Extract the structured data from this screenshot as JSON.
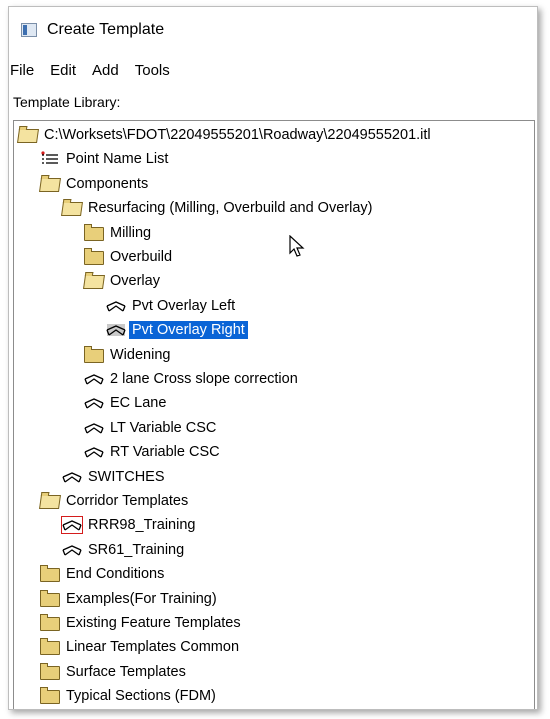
{
  "window": {
    "title": "Create Template"
  },
  "menu": {
    "file": "File",
    "edit": "Edit",
    "add": "Add",
    "tools": "Tools"
  },
  "library_label": "Template Library:",
  "tree": [
    {
      "label": "C:\\Worksets\\FDOT\\22049555201\\Roadway\\22049555201.itl",
      "icon": "folder-open-icon",
      "depth": 0
    },
    {
      "label": "Point Name List",
      "icon": "point-list-icon",
      "depth": 1
    },
    {
      "label": "Components",
      "icon": "folder-open-icon",
      "depth": 1
    },
    {
      "label": "Resurfacing (Milling, Overbuild and Overlay)",
      "icon": "folder-open-icon",
      "depth": 2
    },
    {
      "label": "Milling",
      "icon": "folder-closed-icon",
      "depth": 3
    },
    {
      "label": "Overbuild",
      "icon": "folder-closed-icon",
      "depth": 3
    },
    {
      "label": "Overlay",
      "icon": "folder-open-icon",
      "depth": 3
    },
    {
      "label": "Pvt Overlay Left",
      "icon": "template-icon",
      "depth": 4
    },
    {
      "label": "Pvt Overlay Right",
      "icon": "template-icon-active",
      "depth": 4,
      "selected": true
    },
    {
      "label": "Widening",
      "icon": "folder-closed-icon",
      "depth": 3
    },
    {
      "label": "2 lane Cross slope correction",
      "icon": "template-icon",
      "depth": 3
    },
    {
      "label": "EC Lane",
      "icon": "template-icon",
      "depth": 3
    },
    {
      "label": "LT Variable CSC",
      "icon": "template-icon",
      "depth": 3
    },
    {
      "label": "RT Variable CSC",
      "icon": "template-icon",
      "depth": 3
    },
    {
      "label": "SWITCHES",
      "icon": "template-icon",
      "depth": 2
    },
    {
      "label": "Corridor Templates",
      "icon": "folder-open-icon",
      "depth": 1
    },
    {
      "label": "RRR98_Training",
      "icon": "template-icon-boxed",
      "depth": 2
    },
    {
      "label": "SR61_Training",
      "icon": "template-icon",
      "depth": 2
    },
    {
      "label": "End Conditions",
      "icon": "folder-closed-icon",
      "depth": 1
    },
    {
      "label": "Examples(For Training)",
      "icon": "folder-closed-icon",
      "depth": 1
    },
    {
      "label": "Existing Feature Templates",
      "icon": "folder-closed-icon",
      "depth": 1
    },
    {
      "label": "Linear Templates Common",
      "icon": "folder-closed-icon",
      "depth": 1
    },
    {
      "label": "Surface Templates",
      "icon": "folder-closed-icon",
      "depth": 1
    },
    {
      "label": "Typical Sections (FDM)",
      "icon": "folder-closed-icon",
      "depth": 1
    }
  ],
  "colors": {
    "selection": "#0a64d6",
    "boxed_outline": "#d41c1c"
  }
}
